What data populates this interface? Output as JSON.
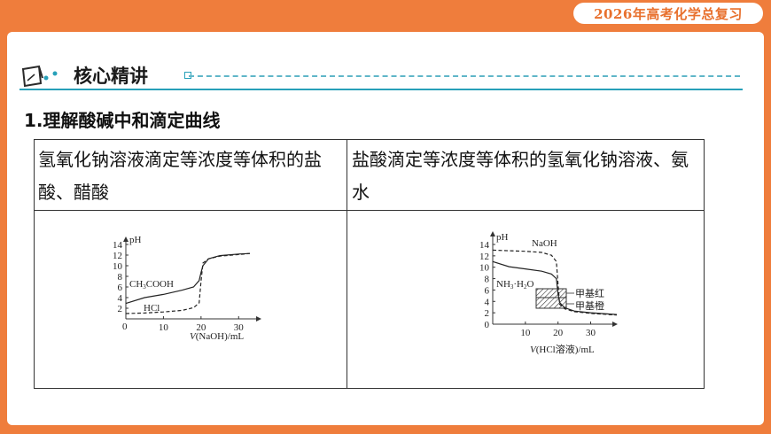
{
  "badge": "2026年高考化学总复习",
  "header": {
    "title": "核心精讲"
  },
  "section": {
    "title": "1.理解酸碱中和滴定曲线"
  },
  "table": {
    "col1_header": "氢氧化钠溶液滴定等浓度等体积的盐酸、醋酸",
    "col2_header": "盐酸滴定等浓度等体积的氢氧化钠溶液、氨水"
  },
  "chart_data": [
    {
      "type": "line",
      "ylabel": "pH",
      "xlabel": "V(NaOH)/mL",
      "x_ticks": [
        0,
        10,
        20,
        30
      ],
      "y_ticks": [
        2,
        4,
        6,
        8,
        10,
        12,
        14
      ],
      "xlim": [
        0,
        33
      ],
      "ylim": [
        0,
        14
      ],
      "series": [
        {
          "name": "CH3COOH",
          "style": "solid",
          "x": [
            0,
            5,
            10,
            15,
            18,
            19.5,
            20,
            20.5,
            22,
            25,
            30,
            34
          ],
          "y": [
            2.9,
            4.0,
            4.6,
            5.4,
            6.0,
            7.2,
            8.7,
            10.0,
            11.3,
            11.9,
            12.2,
            12.3
          ]
        },
        {
          "name": "HCl",
          "style": "dashed",
          "x": [
            0,
            5,
            10,
            15,
            18,
            19.5,
            20,
            20.5,
            22,
            25,
            30,
            34
          ],
          "y": [
            1.0,
            1.1,
            1.3,
            1.6,
            2.1,
            3.0,
            7.0,
            10.5,
            11.3,
            11.8,
            12.1,
            12.3
          ]
        }
      ]
    },
    {
      "type": "line",
      "ylabel": "pH",
      "xlabel": "V(HCl溶液)/mL",
      "x_ticks": [
        10,
        20,
        30
      ],
      "y_ticks": [
        0,
        2,
        4,
        6,
        8,
        10,
        12,
        14
      ],
      "xlim": [
        0,
        38
      ],
      "ylim": [
        0,
        14
      ],
      "series": [
        {
          "name": "NaOH",
          "style": "dashed",
          "x": [
            0,
            5,
            10,
            15,
            18,
            19.5,
            20,
            20.5,
            22,
            25,
            30,
            38
          ],
          "y": [
            13.0,
            12.9,
            12.8,
            12.6,
            12.1,
            11.0,
            7.0,
            3.5,
            2.7,
            2.2,
            1.9,
            1.6
          ]
        },
        {
          "name": "NH3·H2O",
          "style": "solid",
          "x": [
            0,
            5,
            10,
            15,
            18,
            19.5,
            20,
            20.5,
            22,
            25,
            30,
            38
          ],
          "y": [
            11.0,
            10.1,
            9.7,
            9.3,
            8.8,
            8.0,
            5.3,
            3.8,
            2.9,
            2.3,
            2.0,
            1.7
          ]
        }
      ],
      "indicators": [
        {
          "name": "甲基红",
          "ph_range": [
            4.4,
            6.2
          ]
        },
        {
          "name": "甲基橙",
          "ph_range": [
            3.1,
            4.4
          ]
        }
      ]
    }
  ]
}
